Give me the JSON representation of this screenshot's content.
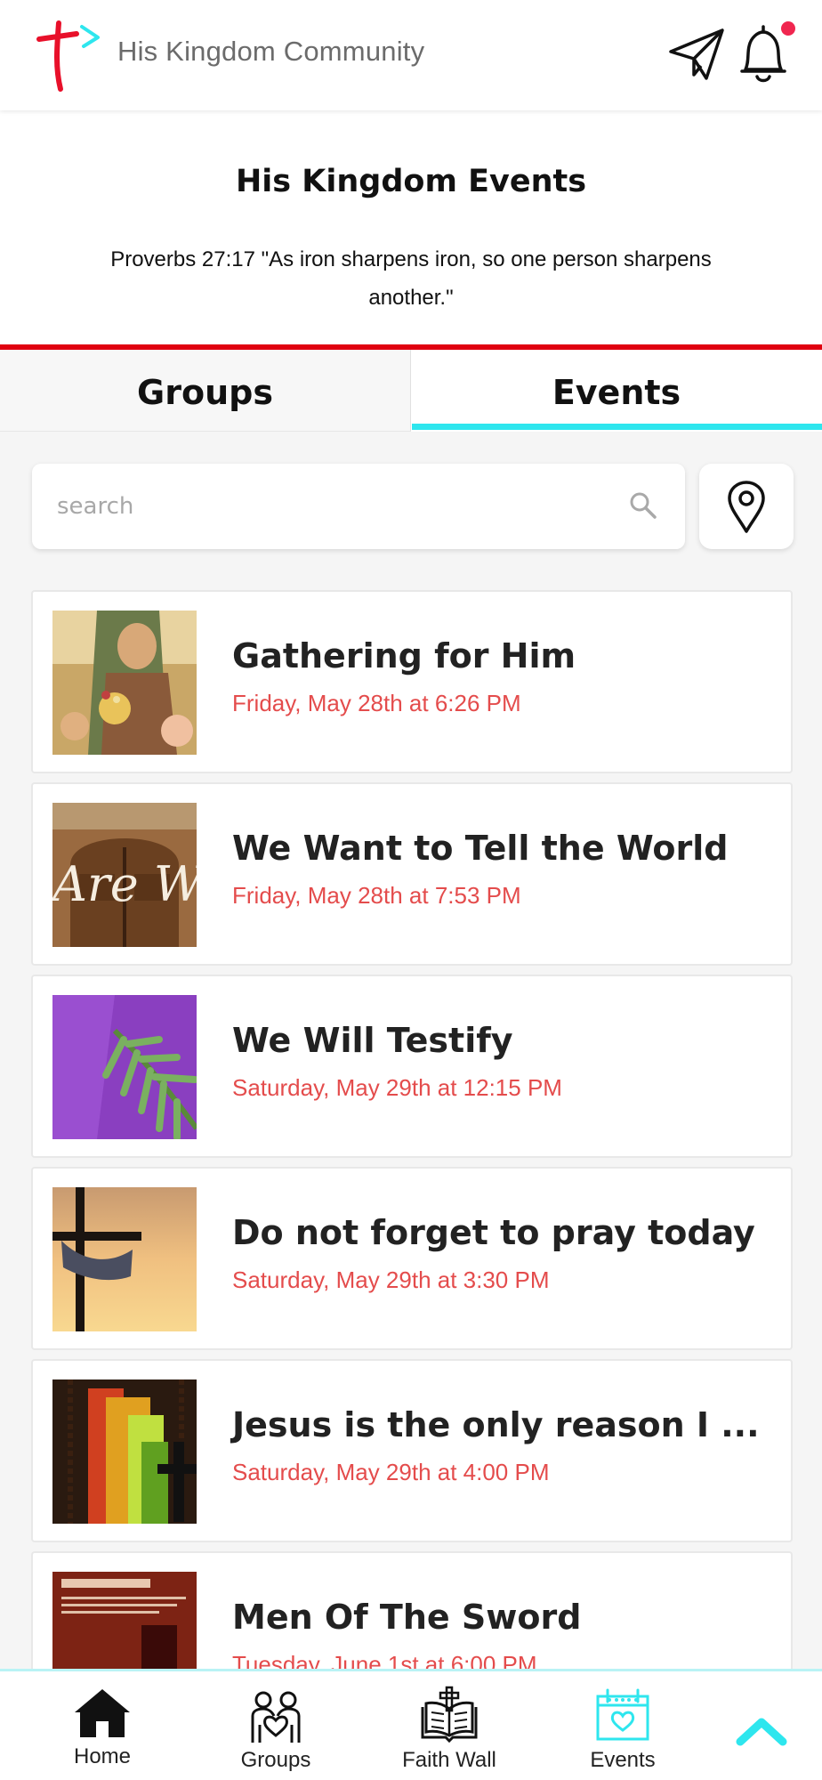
{
  "app": {
    "title": "His Kingdom Community",
    "accent_color": "#2ee6ee",
    "brand_red": "#e00010"
  },
  "header": {
    "title": "His Kingdom Events",
    "verse": "Proverbs 27:17 \"As iron sharpens iron, so one person sharpens another.\""
  },
  "tabs": [
    {
      "label": "Groups",
      "active": false
    },
    {
      "label": "Events",
      "active": true
    }
  ],
  "search": {
    "placeholder": "search"
  },
  "events": [
    {
      "title": "Gathering for Him",
      "date": "Friday, May 28th at 6:26 PM",
      "image": "religious-painting"
    },
    {
      "title": "We Want to Tell the World",
      "date": "Friday, May 28th at 7:53 PM",
      "image": "church-door-welcome"
    },
    {
      "title": "We Will Testify",
      "date": "Saturday, May 29th at 12:15 PM",
      "image": "palm-leaf-purple"
    },
    {
      "title": "Do not forget to pray today",
      "date": "Saturday, May 29th at 3:30 PM",
      "image": "cross-sunset"
    },
    {
      "title": "Jesus is the only reason I ...",
      "date": "Saturday, May 29th at 4:00 PM",
      "image": "rosary-colorful"
    },
    {
      "title": "Men Of The Sword",
      "date": "Tuesday, June 1st at 6:00 PM",
      "image": "men-of-the-sword-poster"
    }
  ],
  "bottom_nav": [
    {
      "label": "Home",
      "icon": "home-icon"
    },
    {
      "label": "Groups",
      "icon": "groups-icon"
    },
    {
      "label": "Faith Wall",
      "icon": "faith-wall-icon"
    },
    {
      "label": "Events",
      "icon": "events-calendar-icon"
    }
  ]
}
